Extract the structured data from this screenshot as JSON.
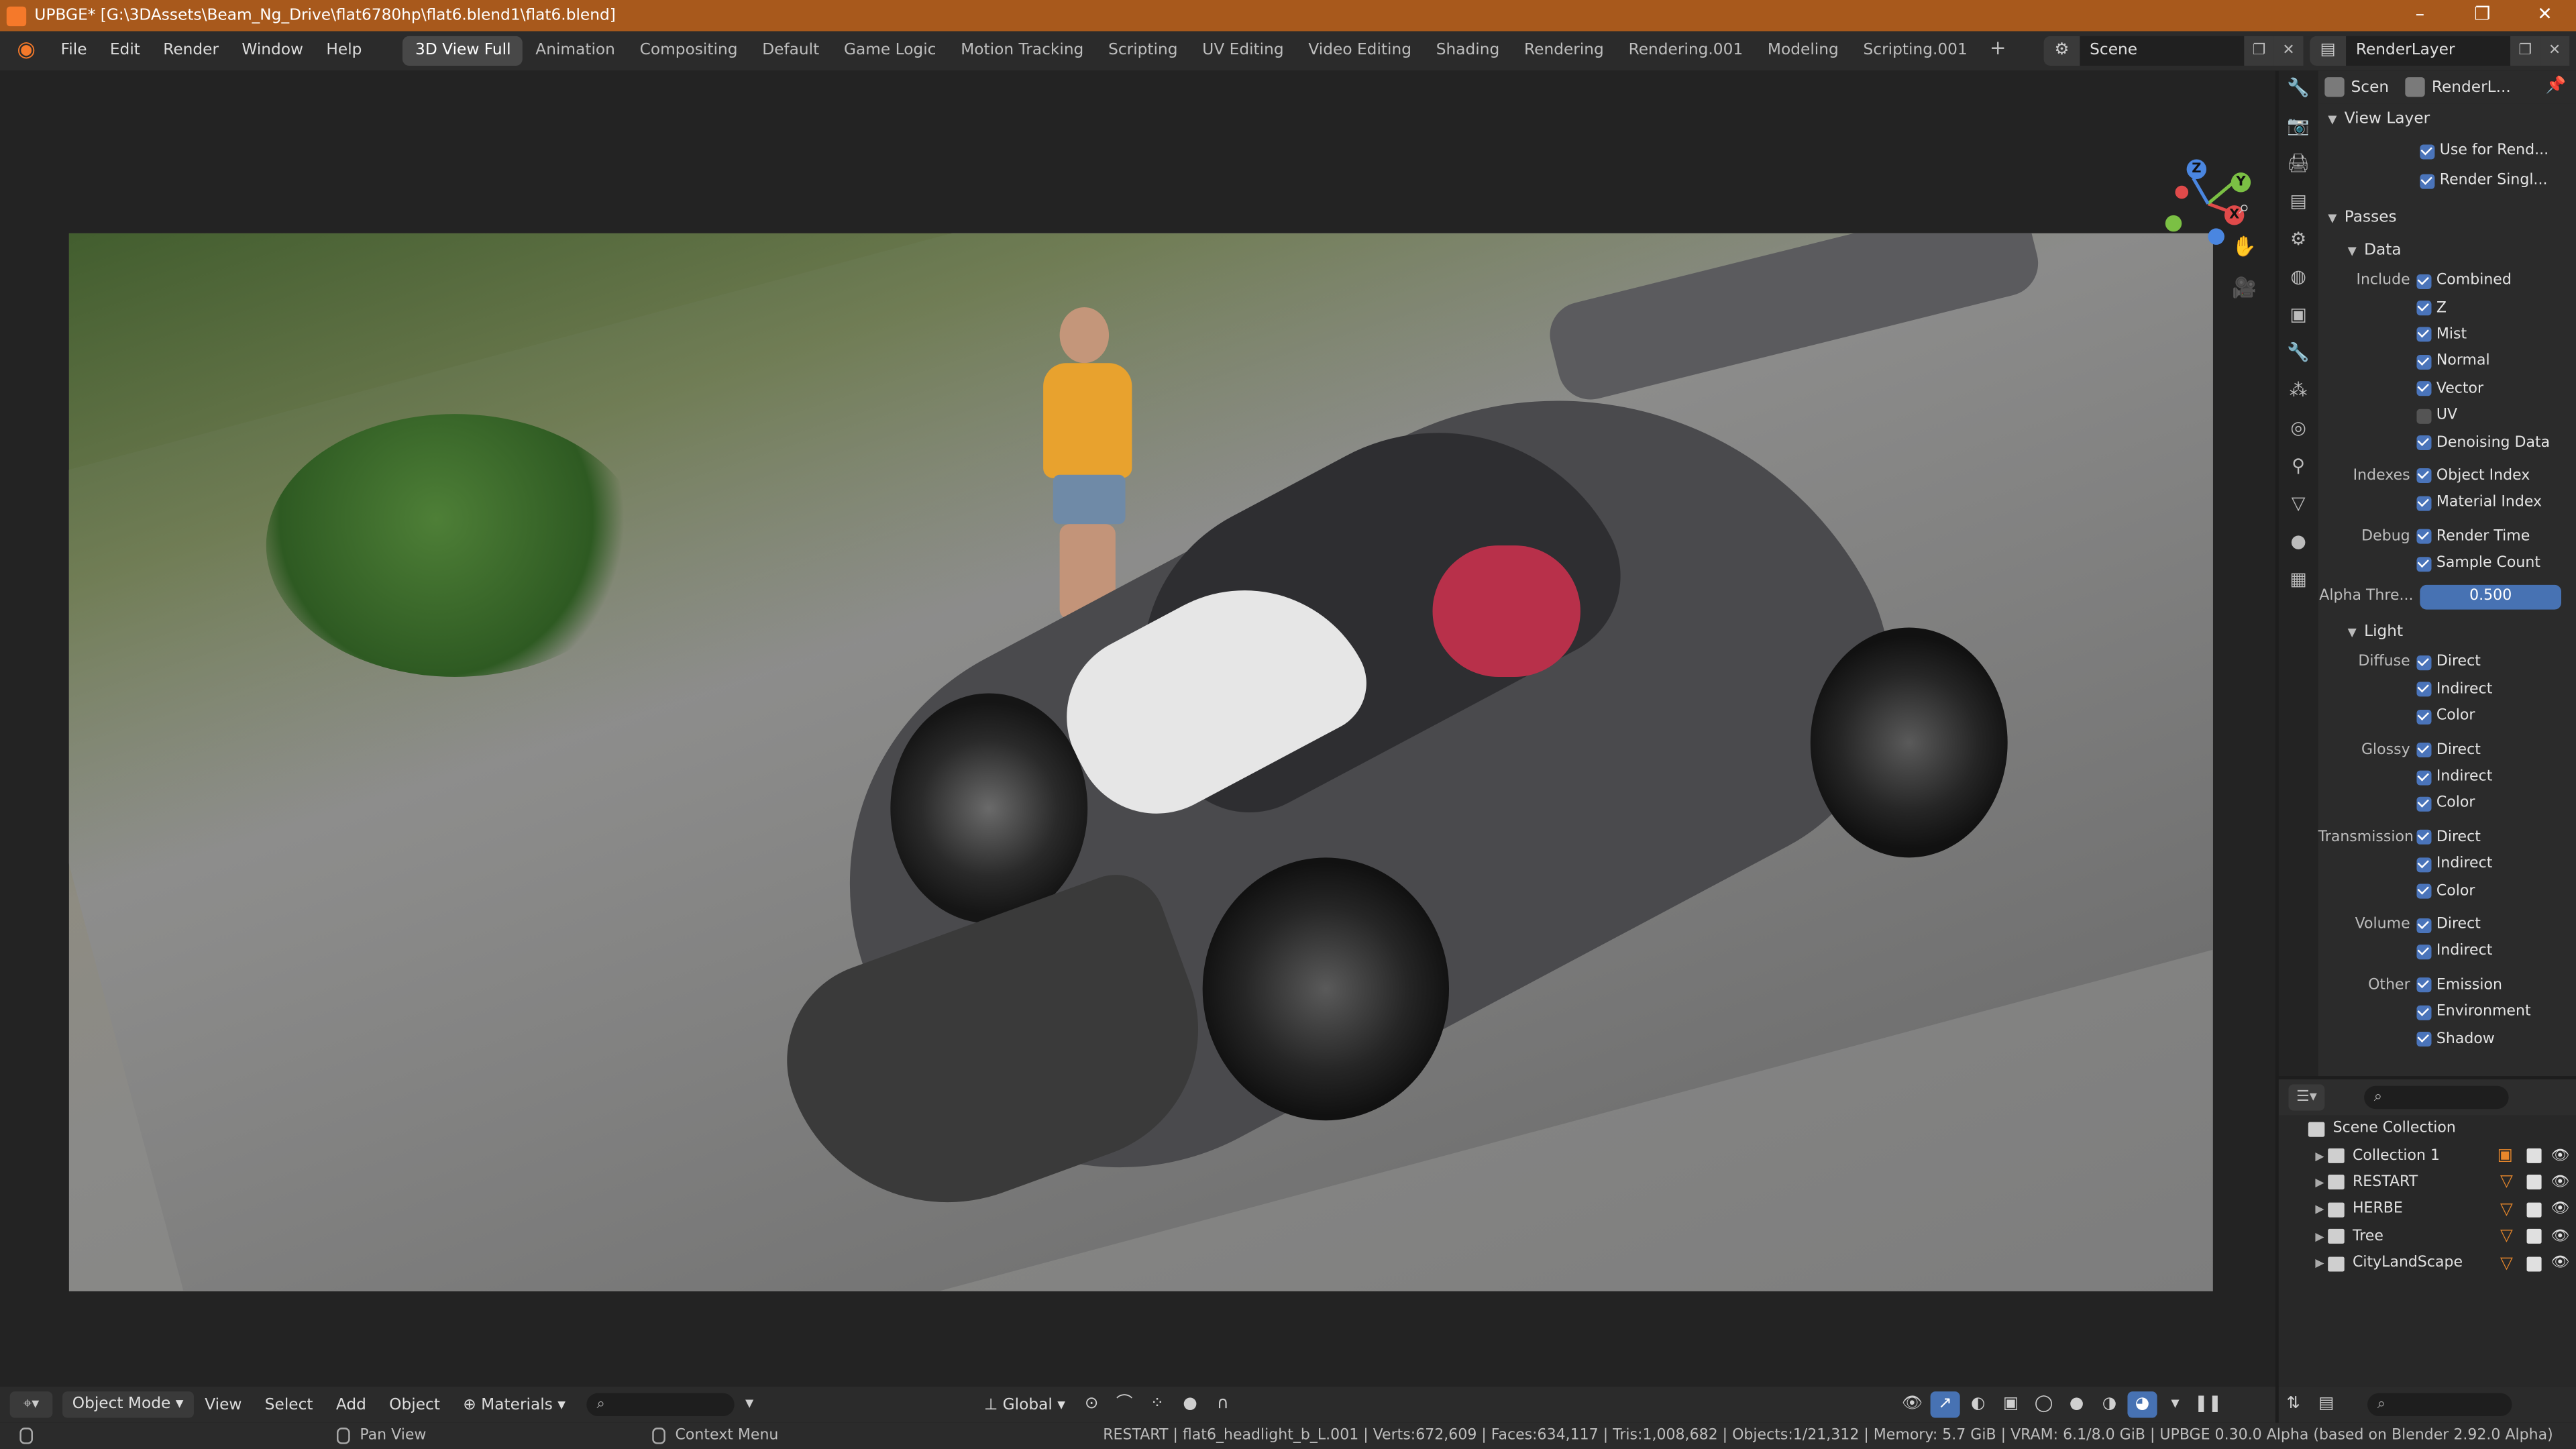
{
  "window": {
    "title": "UPBGE* [G:\\3DAssets\\Beam_Ng_Drive\\flat6780hp\\flat6.blend1\\flat6.blend]",
    "controls": [
      "–",
      "❐",
      "✕"
    ]
  },
  "menu": [
    "File",
    "Edit",
    "Render",
    "Window",
    "Help"
  ],
  "workspaces": [
    {
      "label": "3D View Full",
      "active": true
    },
    {
      "label": "Animation"
    },
    {
      "label": "Compositing"
    },
    {
      "label": "Default"
    },
    {
      "label": "Game Logic"
    },
    {
      "label": "Motion Tracking"
    },
    {
      "label": "Scripting"
    },
    {
      "label": "UV Editing"
    },
    {
      "label": "Video Editing"
    },
    {
      "label": "Shading"
    },
    {
      "label": "Rendering"
    },
    {
      "label": "Rendering.001"
    },
    {
      "label": "Modeling"
    },
    {
      "label": "Scripting.001"
    }
  ],
  "workspace_add": "+",
  "scene": {
    "value": "Scene"
  },
  "render_layer": {
    "value": "RenderLayer"
  },
  "gizmo": {
    "z": "Z",
    "y": "Y",
    "x": "X"
  },
  "properties": {
    "breadcrumb_scene": "Scen",
    "breadcrumb_layer": "RenderL...",
    "view_layer": {
      "title": "View Layer",
      "use_for_render": "Use for Rend...",
      "render_single": "Render Singl..."
    },
    "passes": {
      "title": "Passes",
      "data": {
        "title": "Data",
        "include_label": "Include",
        "combined": "Combined",
        "z": "Z",
        "mist": "Mist",
        "normal": "Normal",
        "vector": "Vector",
        "uv": "UV",
        "denoising": "Denoising Data",
        "indexes_label": "Indexes",
        "object_index": "Object Index",
        "material_index": "Material Index",
        "debug_label": "Debug",
        "render_time": "Render Time",
        "sample_count": "Sample Count",
        "alpha_label": "Alpha Thre...",
        "alpha_value": "0.500"
      },
      "light": {
        "title": "Light",
        "diffuse_label": "Diffuse",
        "glossy_label": "Glossy",
        "transmission_label": "Transmission",
        "volume_label": "Volume",
        "other_label": "Other",
        "direct": "Direct",
        "indirect": "Indirect",
        "color": "Color",
        "emission": "Emission",
        "environment": "Environment",
        "shadow": "Shadow"
      }
    }
  },
  "outliner": {
    "root": "Scene Collection",
    "items": [
      "Collection 1",
      "RESTART",
      "HERBE",
      "Tree",
      "CityLandScape"
    ]
  },
  "viewport_header": {
    "mode": "Object Mode",
    "view": "View",
    "select": "Select",
    "add": "Add",
    "object": "Object",
    "materials": "Materials",
    "orientation": "Global"
  },
  "statusbar": {
    "pan_view": "Pan View",
    "context_menu": "Context Menu",
    "stats": "RESTART | flat6_headlight_b_L.001 | Verts:672,609 | Faces:634,117 | Tris:1,008,682 | Objects:1/21,312 | Memory: 5.7 GiB | VRAM: 6.1/8.0 GiB | UPBGE 0.30.0 Alpha (based on Blender 2.92.0 Alpha)"
  },
  "colors": {
    "titlebar": "#a8591c",
    "accent_blue": "#4772b3",
    "orange": "#e8872b"
  }
}
